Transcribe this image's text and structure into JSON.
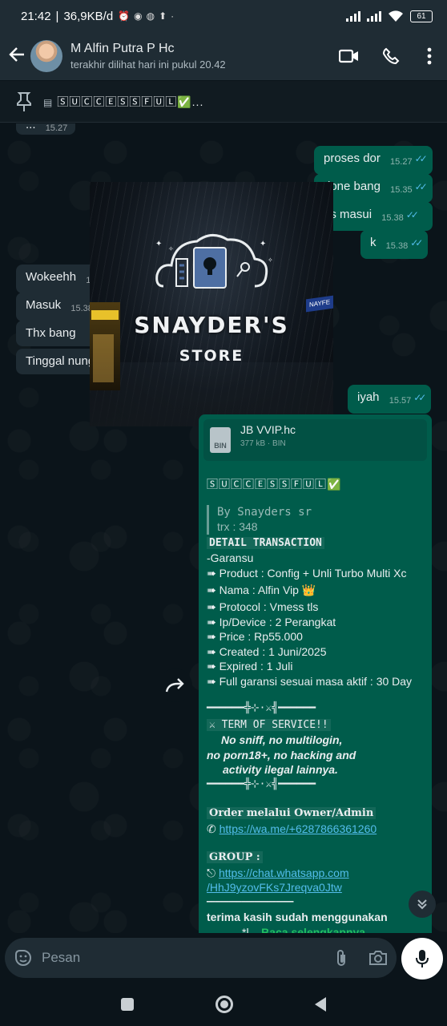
{
  "status_bar": {
    "time": "21:42",
    "speed": "36,9KB/d",
    "battery": "61"
  },
  "header": {
    "contact_name": "M Alfin Putra P Hc",
    "contact_status": "terakhir dilihat hari ini pukul 20.42"
  },
  "pinned": {
    "text": "🅂🅄🄲🄲🄴🅂🅂🄵🅄🄻✅..."
  },
  "messages": {
    "top_partial": {
      "text": "...",
      "time": "15.27"
    },
    "out": [
      {
        "text": "proses dor",
        "time": "15.27"
      },
      {
        "text": "done bang",
        "time": "15.35"
      },
      {
        "text": "es masui",
        "time": "15.38"
      },
      {
        "text": "k",
        "time": "15.38"
      },
      {
        "text": "iyah",
        "time": "15.57"
      }
    ],
    "in": [
      {
        "text": "Wokeehh",
        "time": "15"
      },
      {
        "text": "Masuk",
        "time": "15.38"
      },
      {
        "text": "Thx bang",
        "time": ""
      },
      {
        "text": "Tinggal nungg",
        "time": ""
      }
    ]
  },
  "store_image": {
    "title": "SNAYDER'S",
    "subtitle": "STORE",
    "side_sign": "NAYFE"
  },
  "document": {
    "name": "JB VVIP.hc",
    "size": "377 kB",
    "type": "BIN",
    "icon_label": "BIN"
  },
  "detail": {
    "success": "🅂🅄🄲🄲🄴🅂🅂🄵🅄🄻✅",
    "quote_1": "By Snayders sr",
    "quote_2": "trx : 348",
    "heading": "DETAIL TRANSACTION",
    "garansu": "-Garansu",
    "product": "➠ Product : Config + Unli Turbo Multi Xc",
    "nama": "➠ Nama  : Alfin Vip 👑",
    "protocol": "➠ Protocol : Vmess tls",
    "device": "➠ Ip/Device : 2 Perangkat",
    "price": "➠ Price : Rp55.000",
    "created": "➠ Created  : 1 Juni/2025",
    "expired": "➠ Expired : 1 Juli",
    "garanti": "➠ Full garansi sesuai masa aktif : 30 Day",
    "divider": "━━━━━━╬⊹·⚔╣━━━━━━",
    "tos_title": "⚔ TERM OF SERVICE!!",
    "tos_1": "No sniff, no multilogin,",
    "tos_2": "no porn18+, no hacking and",
    "tos_3": "activity ilegal lainnya.",
    "order_label": "Order melalui Owner/Admin",
    "order_prefix": "✆ ",
    "order_link": "https://wa.me/+6287866361260",
    "group_label": "GROUP  :",
    "group_prefix": "⎋ ",
    "group_link_1": "https://chat.whatsapp.com",
    "group_link_2": "/HhJ9yzovFKs7Jreqva0Jtw",
    "rule": "━━━━━━━━━━━━━━━━━━━━",
    "thanks": "terima kasih sudah menggunakan",
    "more_prefix": "*l...",
    "read_more": "Baca selengkapnya"
  },
  "input": {
    "placeholder": "Pesan"
  },
  "colors": {
    "bg": "#0b141a",
    "outgoing": "#005c4b",
    "incoming": "#1f2c34",
    "tick": "#53bdeb",
    "read_more": "#21c063"
  }
}
